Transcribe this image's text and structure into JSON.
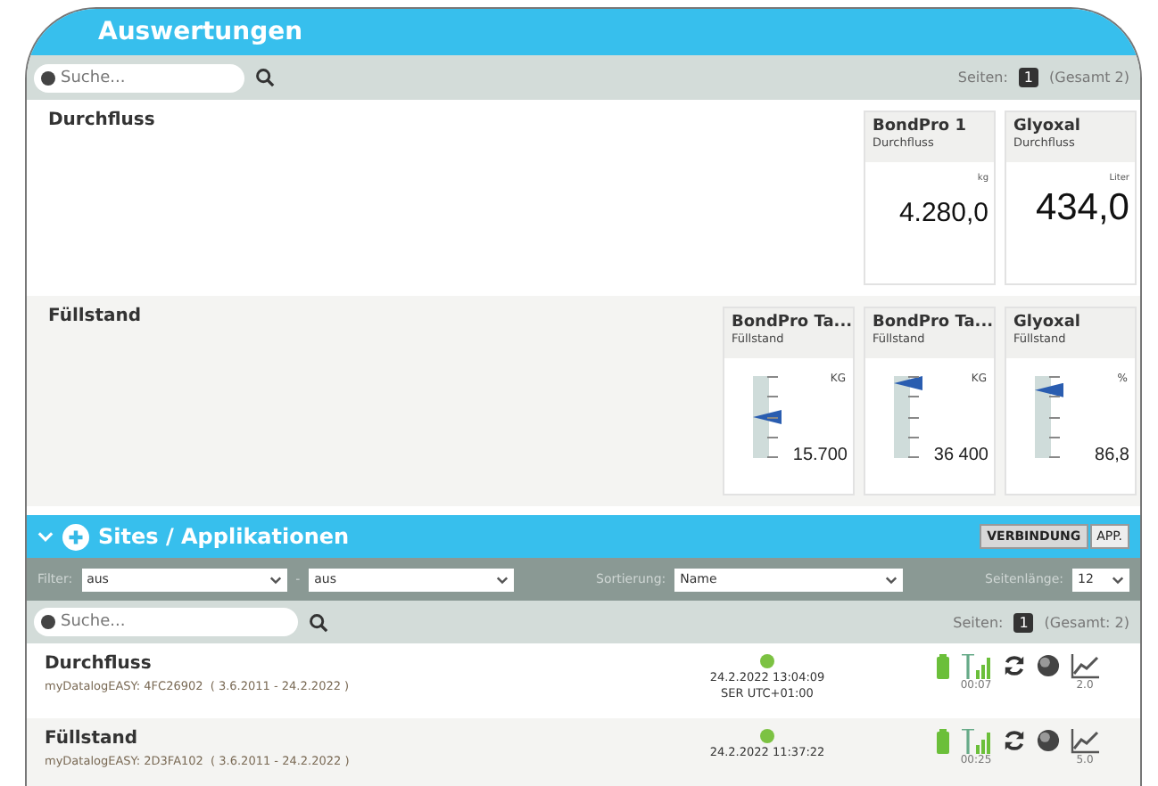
{
  "window": {
    "title": "Auswertungen"
  },
  "toolbar": {
    "search_placeholder": "Suche...",
    "pages_label": "Seiten:",
    "page": "1",
    "total": "(Gesamt 2)"
  },
  "sections": [
    {
      "title": "Durchfluss",
      "cards": [
        {
          "kind": "counter",
          "name": "BondPro 1",
          "type": "Durchfluss",
          "unit": "kg",
          "value": "4.280,0"
        },
        {
          "kind": "counter",
          "name": "Glyoxal",
          "type": "Durchfluss",
          "unit": "Liter",
          "value": "434,0"
        }
      ]
    },
    {
      "title": "Füllstand",
      "cards": [
        {
          "kind": "gauge",
          "name": "BondPro Ta...",
          "type": "Füllstand",
          "unit": "KG",
          "value": "15.700",
          "level": 0.5
        },
        {
          "kind": "gauge",
          "name": "BondPro Ta...",
          "type": "Füllstand",
          "unit": "KG",
          "value": "36 400",
          "level": 1.0
        },
        {
          "kind": "gauge",
          "name": "Glyoxal",
          "type": "Füllstand",
          "unit": "%",
          "value": "86,8",
          "level": 0.9
        }
      ]
    }
  ],
  "sites": {
    "title": "Sites / Applikationen",
    "view_buttons": [
      {
        "label": "VERBINDUNG",
        "selected": true
      },
      {
        "label": "APP.",
        "selected": false
      }
    ],
    "filter_label": "Filter:",
    "filter_1": "aus",
    "filter_sep": "-",
    "filter_2": "aus",
    "sort_label": "Sortierung:",
    "sort": "Name",
    "length_label": "Seitenlänge:",
    "length": "12",
    "search_placeholder": "Suche...",
    "pages_label": "Seiten:",
    "page": "1",
    "total": "(Gesamt: 2)",
    "rows": [
      {
        "name": "Durchfluss",
        "device": "myDatalogEASY: 4FC26902",
        "range": "( 3.6.2011 - 24.2.2022 )",
        "color": "#7cc242",
        "time": "24.2.2022 13:04:09",
        "zone": "SER UTC+01:00",
        "signal_time": "00:07",
        "chart_value": "2.0"
      },
      {
        "name": "Füllstand",
        "device": "myDatalogEASY: 2D3FA102",
        "range": "( 3.6.2011 - 24.2.2022 )",
        "color": "#7cc242",
        "time": "24.2.2022 11:37:22",
        "signal_time": "00:25",
        "chart_value": "5.0"
      }
    ]
  }
}
